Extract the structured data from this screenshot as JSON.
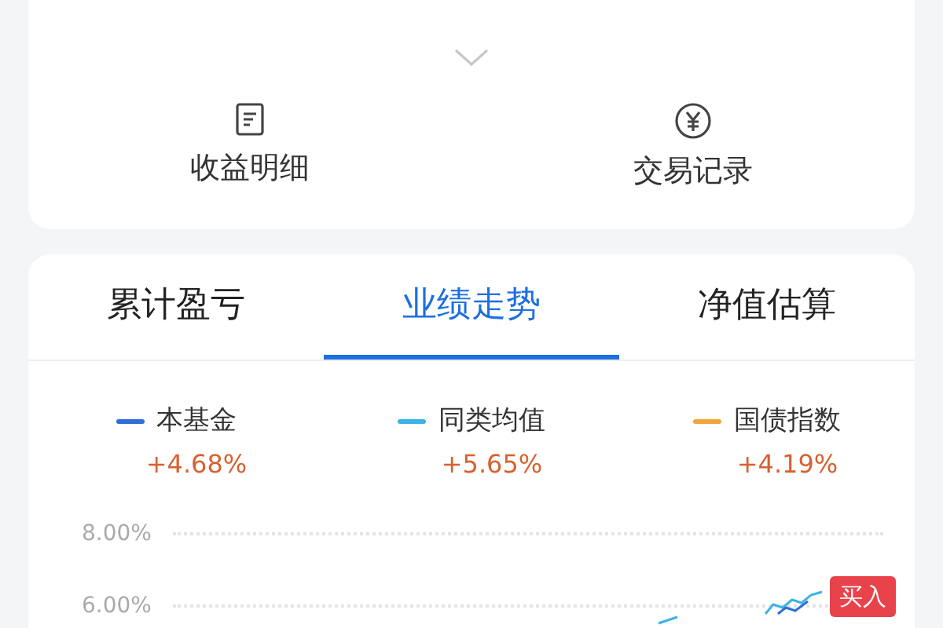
{
  "actions": [
    {
      "label": "收益明细",
      "kind": "document"
    },
    {
      "label": "交易记录",
      "kind": "yen"
    }
  ],
  "tabs": [
    {
      "label": "累计盈亏",
      "selected": false
    },
    {
      "label": "业绩走势",
      "selected": true
    },
    {
      "label": "净值估算",
      "selected": false
    }
  ],
  "legend": [
    {
      "name": "本基金",
      "value": "+4.68%",
      "color": "#2f6fd6"
    },
    {
      "name": "同类均值",
      "value": "+5.65%",
      "color": "#3bb3e6"
    },
    {
      "name": "国债指数",
      "value": "+4.19%",
      "color": "#f0a63a"
    }
  ],
  "y_axis_labels": [
    "8.00%",
    "6.00%"
  ],
  "buy_marker": "买入"
}
